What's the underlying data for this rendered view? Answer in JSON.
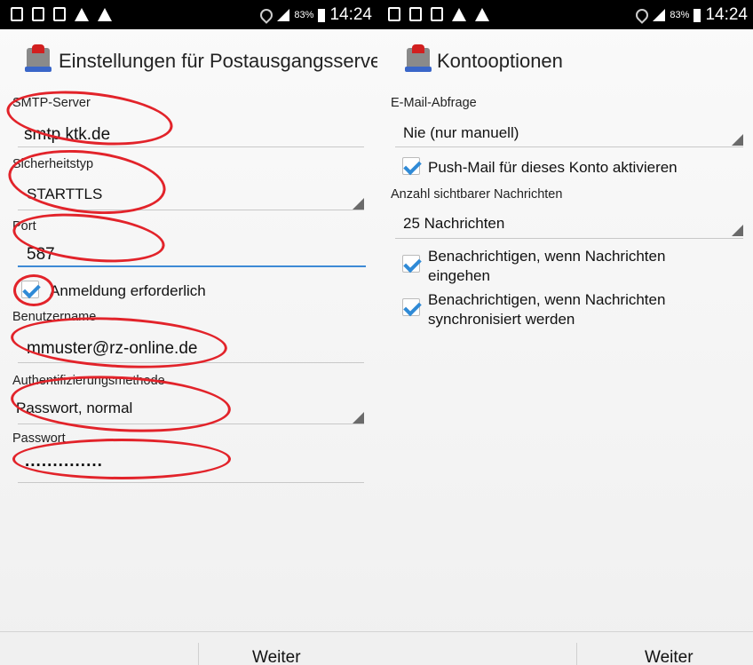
{
  "left": {
    "status": {
      "battery": "83%",
      "time": "14:24"
    },
    "title": "Einstellungen für Postausgangsserver",
    "smtp_label": "SMTP-Server",
    "smtp_value": "smtp.ktk.de",
    "security_label": "Sicherheitstyp",
    "security_value": "STARTTLS",
    "port_label": "Port",
    "port_value": "587",
    "login_required": "Anmeldung erforderlich",
    "username_label": "Benutzername",
    "username_value": "mmuster@rz-online.de",
    "auth_label": "Authentifizierungsmethode",
    "auth_value": "Passwort, normal",
    "password_label": "Passwort",
    "password_value": "..............",
    "next": "Weiter"
  },
  "right": {
    "status": {
      "battery": "83%",
      "time": "14:24"
    },
    "title": "Kontooptionen",
    "check_frequency_label": "E-Mail-Abfrage",
    "check_frequency_value": "Nie (nur manuell)",
    "push_mail": "Push-Mail für dieses Konto aktivieren",
    "visible_messages_label": "Anzahl sichtbarer Nachrichten",
    "visible_messages_value": "25 Nachrichten",
    "notify_incoming": "Benachrichtigen, wenn Nachrichten eingehen",
    "notify_sync": "Benachrichtigen, wenn Nachrichten synchronisiert werden",
    "next": "Weiter"
  },
  "colors": {
    "accent": "#2f8ad6",
    "highlight_ring": "#e2232a"
  },
  "checkbox_states": {
    "login_required": true,
    "push_mail": true,
    "notify_incoming": true,
    "notify_sync": true
  }
}
